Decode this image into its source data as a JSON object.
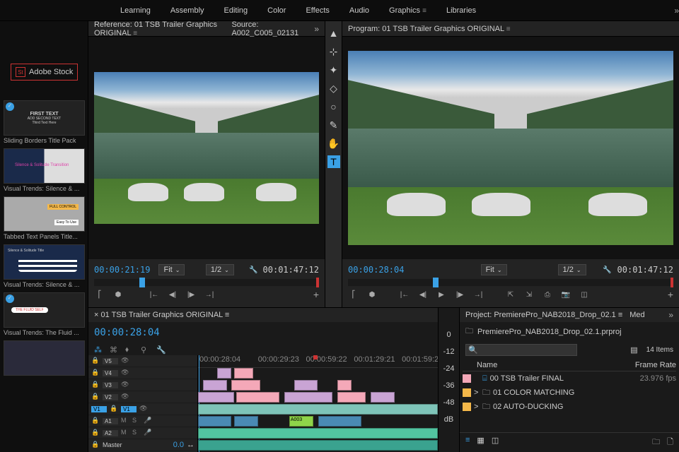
{
  "workspace_tabs": [
    "Learning",
    "Assembly",
    "Editing",
    "Color",
    "Effects",
    "Audio",
    "Graphics",
    "Libraries"
  ],
  "workspace_active": "Graphics",
  "adobe_stock_label": "Adobe Stock",
  "templates": [
    {
      "title": "Sliding Borders Title Pack",
      "caption": "FIRST TEXT"
    },
    {
      "title": "Visual Trends: Silence & ...",
      "caption": "Silence & Solitude Transition"
    },
    {
      "title": "Tabbed Text Panels Title...",
      "caption": "FULL CONTROL"
    },
    {
      "title": "Visual Trends: Silence & ...",
      "caption": "Silence & Solitude Title"
    },
    {
      "title": "Visual Trends: The Fluid ...",
      "caption": ""
    },
    {
      "title": "",
      "caption": ""
    }
  ],
  "reference": {
    "tab_label": "Reference: 01 TSB Trailer Graphics ORIGINAL",
    "source_tab": "Source: A002_C005_02131",
    "timecode_in": "00:00:21:19",
    "timecode_out": "00:01:47:12",
    "fit_label": "Fit",
    "res_label": "1/2"
  },
  "program": {
    "tab_label": "Program: 01 TSB Trailer Graphics ORIGINAL",
    "timecode_in": "00:00:28:04",
    "timecode_out": "00:01:47:12",
    "fit_label": "Fit",
    "res_label": "1/2"
  },
  "timeline": {
    "sequence_name": "01 TSB Trailer Graphics ORIGINAL",
    "playhead_tc": "00:00:28:04",
    "time_marks": [
      "00:00:28:04",
      "00:00:29:23",
      "00:00:59:22",
      "00:01:29:21",
      "00:01:59:21"
    ],
    "video_tracks": [
      "V5",
      "V4",
      "V3",
      "V2",
      "V1"
    ],
    "audio_tracks": [
      "A1",
      "A2"
    ],
    "master_label": "Master",
    "v1_source": "V1",
    "audio_scale_label": "0.0",
    "clip_label_a003": "A003"
  },
  "audio_meter": {
    "marks": [
      "0",
      "-12",
      "-24",
      "-36",
      "-48",
      "dB"
    ]
  },
  "project": {
    "panel_title": "Project: PremierePro_NAB2018_Drop_02.1",
    "other_tab": "Med",
    "project_file": "PremierePro_NAB2018_Drop_02.1.prproj",
    "item_count": "14 Items",
    "columns": {
      "name": "Name",
      "framerate": "Frame Rate"
    },
    "items": [
      {
        "swatch": "#f4a8b8",
        "name": "00 TSB Trailer FINAL",
        "framerate": "23.976 fps",
        "icon": "sequence",
        "chevron": ""
      },
      {
        "swatch": "#f4b84a",
        "name": "01 COLOR MATCHING",
        "framerate": "",
        "icon": "bin",
        "chevron": ">"
      },
      {
        "swatch": "#f4b84a",
        "name": "02 AUTO-DUCKING",
        "framerate": "",
        "icon": "bin",
        "chevron": ">"
      }
    ]
  }
}
